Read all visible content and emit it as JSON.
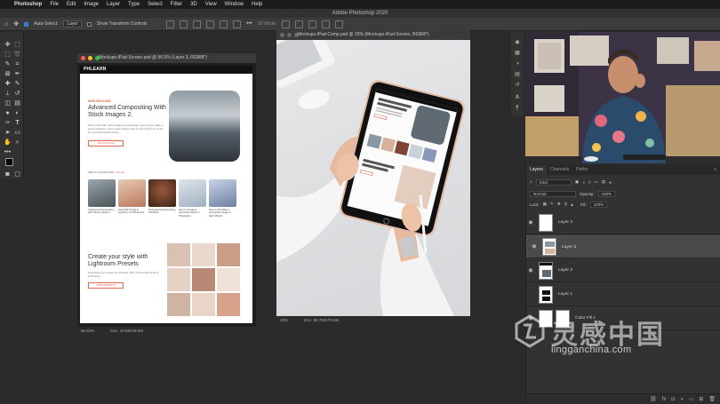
{
  "menubar": {
    "apple": "",
    "app": "Photoshop",
    "items": [
      "File",
      "Edit",
      "Image",
      "Layer",
      "Type",
      "Select",
      "Filter",
      "3D",
      "View",
      "Window",
      "Help"
    ]
  },
  "app_title": "Adobe Photoshop 2020",
  "options": {
    "auto_select_label": "Auto-Select:",
    "auto_select_value": "Layer",
    "transform_label": "Show Transform Controls",
    "mode_label": "3D Mode:"
  },
  "doc1": {
    "title": "Mockups-iPad-Screen.psd @ 56.5% (Layer 3, RGB/8*)",
    "zoom": "56.54%",
    "doc_size": "Doc: 10.8M/49.5M",
    "page": {
      "logo": "PHLEARN",
      "badge": "NEW RELEASE",
      "headline": "Advanced Compositing With Stock Images 2.",
      "body": "We're back with more fantasy compositing! Learn how to take a stock collection of fun stock photos and combine them to create an out-of-this-world scene.",
      "cta": "WATCH NOW",
      "related_label": "ADD TO COLLECTION",
      "related_link": "View all",
      "cards": [
        {
          "caption": "Advanced Compositing with Stock Images 2"
        },
        {
          "caption": "Soft Split Toning in Lightroom & Photoshop"
        },
        {
          "caption": "Professional Retouching Workflow"
        },
        {
          "caption": "How to Create a Cinematic Movie in Photoshop"
        },
        {
          "caption": "How to Simulate a Composite Image in After Effects"
        }
      ],
      "section_headline": "Create your style with Lightroom Presets",
      "section_body": "Download your Lightroom Presets: 50%, Photoshop Actions & Brushes.",
      "section_cta": "VIEW PRESETS"
    }
  },
  "doc2": {
    "title": "Mockups-iPad-Comp.psd @ 25% (Mockups-iPad-Screen, RGB/8*)",
    "zoom": "25%",
    "doc_size": "Doc: 68.7M/278.5M"
  },
  "layers_panel": {
    "tabs": [
      "Layers",
      "Channels",
      "Paths"
    ],
    "kind_label": "Kind",
    "blend_mode": "Normal",
    "opacity_label": "Opacity:",
    "opacity_value": "100%",
    "lock_label": "Lock:",
    "fill_label": "Fill:",
    "fill_value": "100%",
    "layers": [
      {
        "name": "Layer 4",
        "selected": false
      },
      {
        "name": "Layer 3",
        "selected": true
      },
      {
        "name": "Layer 2",
        "selected": false
      },
      {
        "name": "Layer 1",
        "selected": false
      },
      {
        "name": "Color Fill 1",
        "selected": false
      }
    ]
  },
  "watermark": {
    "chinese": "灵感中国",
    "domain": "lingganchina.com"
  },
  "colors": {
    "accent": "#e06a4f",
    "panel": "#323232",
    "workspace": "#2b2b2b"
  }
}
